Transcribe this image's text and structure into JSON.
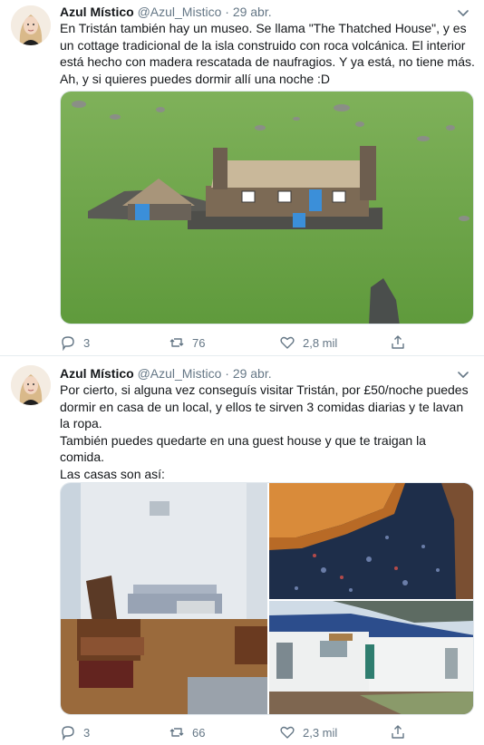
{
  "tweets": [
    {
      "display_name": "Azul Místico",
      "handle": "@Azul_Mistico",
      "separator": "·",
      "time": "29 abr.",
      "lines": [
        "En Tristán también hay un museo. Se llama \"The Thatched House\", y es",
        "un cottage tradicional de la isla construido con roca volcánica. El interior",
        "está hecho con madera rescatada de naufragios. Y ya está, no tiene más.",
        "Ah, y si quieres puedes dormir allí una noche :D"
      ],
      "replies": "3",
      "retweets": "76",
      "likes": "2,8 mil"
    },
    {
      "display_name": "Azul Místico",
      "handle": "@Azul_Mistico",
      "separator": "·",
      "time": "29 abr.",
      "lines": [
        "Por cierto, si alguna vez conseguís visitar Tristán, por £50/noche puedes",
        "dormir en casa de un local, y ellos te sirven 3 comidas diarias y te lavan",
        "la ropa.",
        "También puedes quedarte en una guest house y que te traigan la",
        "comida.",
        "Las casas son así:"
      ],
      "replies": "3",
      "retweets": "66",
      "likes": "2,3 mil"
    }
  ],
  "icons": {
    "reply": "reply-icon",
    "retweet": "retweet-icon",
    "like": "heart-icon",
    "share": "share-icon",
    "caret": "chevron-down-icon"
  },
  "colors": {
    "text": "#14171a",
    "secondary": "#657786",
    "border": "#e6ecf0",
    "grass": "#6fa34a",
    "door": "#3b8fd9"
  }
}
